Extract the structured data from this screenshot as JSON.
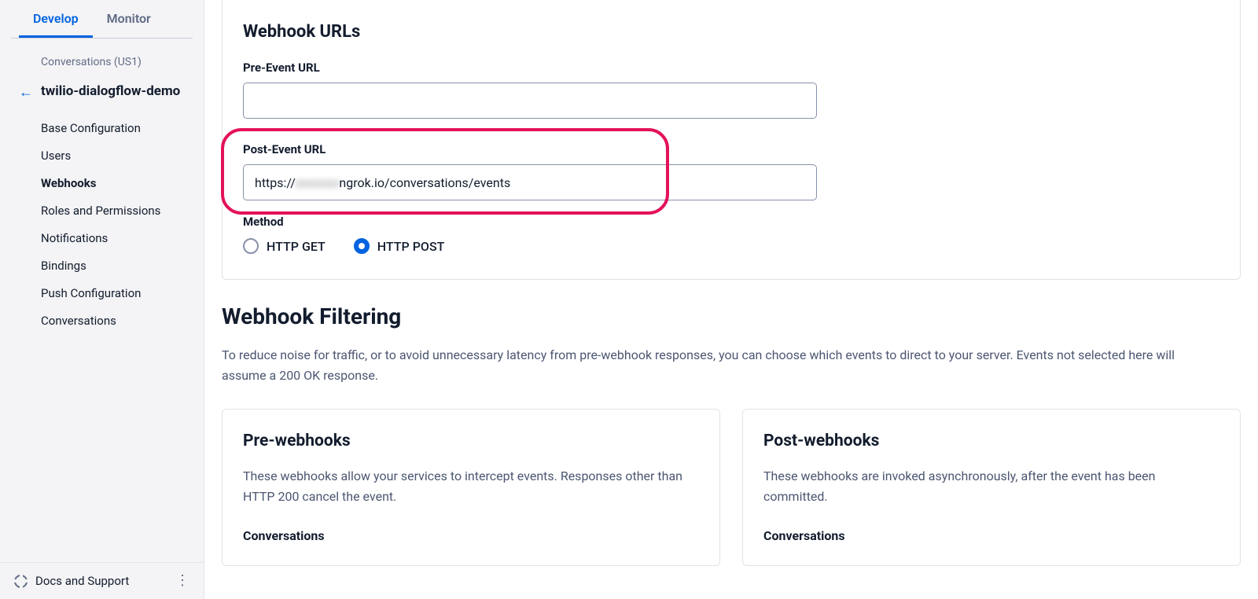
{
  "sidebar": {
    "tabs": [
      {
        "label": "Develop",
        "active": true
      },
      {
        "label": "Monitor",
        "active": false
      }
    ],
    "breadcrumb": "Conversations (US1)",
    "title": "twilio-dialogflow-demo",
    "items": [
      {
        "label": "Base Configuration",
        "selected": false
      },
      {
        "label": "Users",
        "selected": false
      },
      {
        "label": "Webhooks",
        "selected": true
      },
      {
        "label": "Roles and Permissions",
        "selected": false
      },
      {
        "label": "Notifications",
        "selected": false
      },
      {
        "label": "Bindings",
        "selected": false
      },
      {
        "label": "Push Configuration",
        "selected": false
      },
      {
        "label": "Conversations",
        "selected": false
      }
    ],
    "footer": "Docs and Support"
  },
  "main": {
    "urls_heading": "Webhook URLs",
    "pre_event": {
      "label": "Pre-Event URL",
      "value": ""
    },
    "post_event": {
      "label": "Post-Event URL",
      "value_prefix": "https://",
      "value_blurred": "xxxxxxx",
      "value_suffix": "ngrok.io/conversations/events"
    },
    "method": {
      "label": "Method",
      "options": [
        {
          "label": "HTTP GET",
          "checked": false
        },
        {
          "label": "HTTP POST",
          "checked": true
        }
      ]
    },
    "filtering": {
      "heading": "Webhook Filtering",
      "description": "To reduce noise for traffic, or to avoid unnecessary latency from pre-webhook responses, you can choose which events to direct to your server. Events not selected here will assume a 200 OK response."
    },
    "webhook_cards": [
      {
        "title": "Pre-webhooks",
        "description": "These webhooks allow your services to intercept events. Responses other than HTTP 200 cancel the event.",
        "subhead": "Conversations"
      },
      {
        "title": "Post-webhooks",
        "description": "These webhooks are invoked asynchronously, after the event has been committed.",
        "subhead": "Conversations"
      }
    ]
  }
}
